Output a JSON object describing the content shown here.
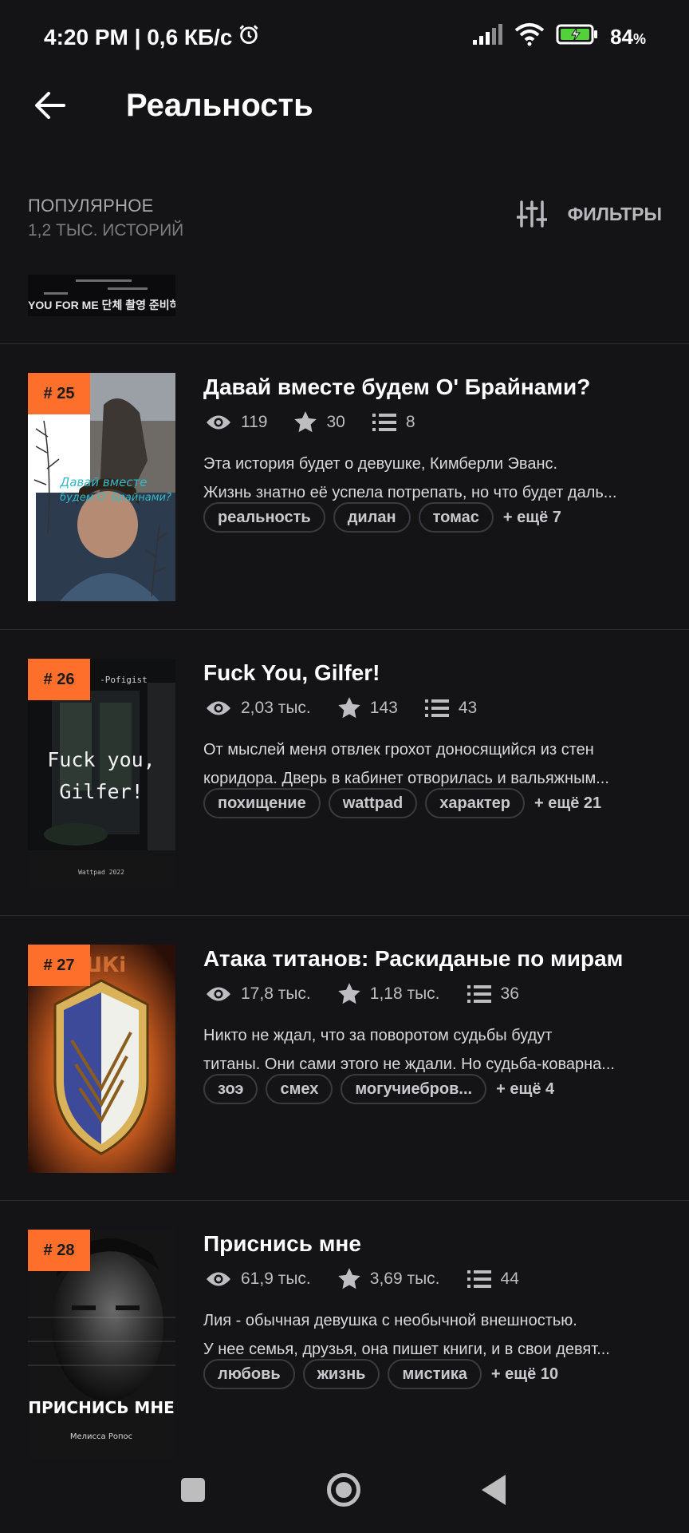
{
  "status_bar": {
    "time_speed": "4:20 PM | 0,6 КБ/с",
    "battery": "84",
    "battery_unit": "%"
  },
  "toolbar": {
    "title": "Реальность"
  },
  "sort": {
    "title": "ПОПУЛЯРНОЕ",
    "count": "1,2 ТЫС. ИСТОРИЙ",
    "filter_label": "ФИЛЬТРЫ"
  },
  "top_partial": {
    "cover_text": "YOU FOR ME 단체 촬영 준비하라"
  },
  "stories": [
    {
      "rank": "# 25",
      "title": "Давай вместе будем О' Брайнами?",
      "views": "119",
      "votes": "30",
      "parts": "8",
      "desc_line1": "Эта история будет о девушке, Кимберли Эванс.",
      "desc_line2": "Жизнь знатно её успела потрепать, но что будет даль...",
      "tags": [
        "реальность",
        "дилан",
        "томас"
      ],
      "more": "+ ещё 7",
      "cover_text": "Давай вместе будем О' Брайнами?"
    },
    {
      "rank": "# 26",
      "title": "Fuck You, Gilfer!",
      "views": "2,03 тыс.",
      "votes": "143",
      "parts": "43",
      "desc_line1": "От мыслей меня отвлек грохот доносящийся из стен",
      "desc_line2": "коридора. Дверь в кабинет отворилась и вальяжным...",
      "tags": [
        "похищение",
        "wattpad",
        "характер"
      ],
      "more": "+ ещё 21",
      "cover_author": "-Pofigist",
      "cover_line1": "Fuck you,",
      "cover_line2": "Gilfer!",
      "cover_foot": "Wattpad 2022"
    },
    {
      "rank": "# 27",
      "title": "Атака титанов: Раскиданые по мирам",
      "views": "17,8 тыс.",
      "votes": "1,18 тыс.",
      "parts": "36",
      "desc_line1": "Никто не ждал, что за поворотом судьбы будут",
      "desc_line2": "титаны. Они сами этого не ждали. Но судьба-коварна...",
      "tags": [
        "зоэ",
        "смех",
        "могучиебров..."
      ],
      "more": "+ ещё 4"
    },
    {
      "rank": "# 28",
      "title": "Приснись мне",
      "views": "61,9 тыс.",
      "votes": "3,69 тыс.",
      "parts": "44",
      "desc_line1": "Лия - обычная девушка с необычной внешностью.",
      "desc_line2": "У нее семья, друзья, она пишет книги, и в свои девят...",
      "tags": [
        "любовь",
        "жизнь",
        "мистика"
      ],
      "more": "+ ещё 10",
      "cover_title": "ПРИСНИСЬ МНЕ",
      "cover_author": "Мелисса Ропос"
    }
  ]
}
